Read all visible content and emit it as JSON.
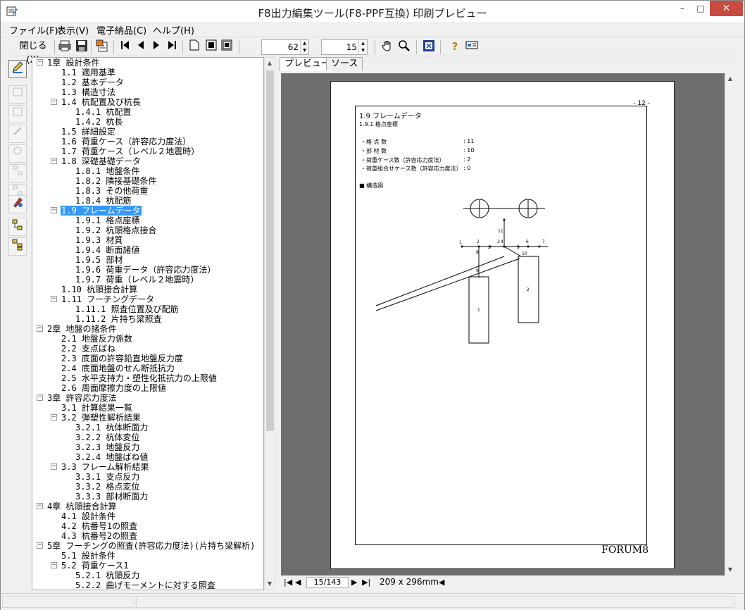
{
  "window": {
    "title": "F8出力編集ツール(F8-PPF互換) 印刷プレビュー",
    "minimize": "–",
    "maximize": "□",
    "close": "✕"
  },
  "menu": [
    "ファイル(F)",
    "表示(V)",
    "電子納品(C)",
    "ヘルプ(H)"
  ],
  "toolbar": {
    "close_label": "閉じる(X)",
    "zoom_value": "62",
    "page_value": "15"
  },
  "tabs": [
    "プレビュー",
    "ソース"
  ],
  "tree": [
    {
      "label": "1章 設計条件",
      "level": 0,
      "expander": "−"
    },
    {
      "label": "1.1 適用基準",
      "level": 1
    },
    {
      "label": "1.2 基本データ",
      "level": 1
    },
    {
      "label": "1.3 構造寸法",
      "level": 1
    },
    {
      "label": "1.4 杭配置及び杭長",
      "level": 1,
      "expander": "−"
    },
    {
      "label": "1.4.1 杭配置",
      "level": 2
    },
    {
      "label": "1.4.2 杭長",
      "level": 2
    },
    {
      "label": "1.5 詳細設定",
      "level": 1
    },
    {
      "label": "1.6 荷重ケース（許容応力度法）",
      "level": 1
    },
    {
      "label": "1.7 荷重ケース（レベル２地震時）",
      "level": 1
    },
    {
      "label": "1.8 深礎基礎データ",
      "level": 1,
      "expander": "−"
    },
    {
      "label": "1.8.1 地盤条件",
      "level": 2
    },
    {
      "label": "1.8.2 隣接基礎条件",
      "level": 2
    },
    {
      "label": "1.8.3 その他荷重",
      "level": 2
    },
    {
      "label": "1.8.4 杭配筋",
      "level": 2
    },
    {
      "label": "1.9 フレームデータ",
      "level": 1,
      "expander": "−",
      "selected": true
    },
    {
      "label": "1.9.1 格点座標",
      "level": 2
    },
    {
      "label": "1.9.2 杭頭格点接合",
      "level": 2
    },
    {
      "label": "1.9.3 材質",
      "level": 2
    },
    {
      "label": "1.9.4 断面諸値",
      "level": 2
    },
    {
      "label": "1.9.5 部材",
      "level": 2
    },
    {
      "label": "1.9.6 荷重データ（許容応力度法）",
      "level": 2
    },
    {
      "label": "1.9.7 荷重（レベル２地震時）",
      "level": 2
    },
    {
      "label": "1.10 杭頭接合計算",
      "level": 1
    },
    {
      "label": "1.11 フーチングデータ",
      "level": 1,
      "expander": "−"
    },
    {
      "label": "1.11.1 照査位置及び配筋",
      "level": 2
    },
    {
      "label": "1.11.2 片持ち梁照査",
      "level": 2
    },
    {
      "label": "2章 地盤の諸条件",
      "level": 0,
      "expander": "−"
    },
    {
      "label": "2.1 地盤反力係数",
      "level": 1
    },
    {
      "label": "2.2 支点ばね",
      "level": 1
    },
    {
      "label": "2.3 底面の許容鉛直地盤反力度",
      "level": 1
    },
    {
      "label": "2.4 底面地盤のせん断抵抗力",
      "level": 1
    },
    {
      "label": "2.5 水平支持力・塑性化抵抗力の上限値",
      "level": 1
    },
    {
      "label": "2.6 周面摩擦力度の上限値",
      "level": 1
    },
    {
      "label": "3章 許容応力度法",
      "level": 0,
      "expander": "−"
    },
    {
      "label": "3.1 計算結果一覧",
      "level": 1
    },
    {
      "label": "3.2 弾塑性解析結果",
      "level": 1,
      "expander": "−"
    },
    {
      "label": "3.2.1 杭体断面力",
      "level": 2
    },
    {
      "label": "3.2.2 杭体変位",
      "level": 2
    },
    {
      "label": "3.2.3 地盤反力",
      "level": 2
    },
    {
      "label": "3.2.4 地盤ばね値",
      "level": 2
    },
    {
      "label": "3.3 フレーム解析結果",
      "level": 1,
      "expander": "−"
    },
    {
      "label": "3.3.1 支点反力",
      "level": 2
    },
    {
      "label": "3.3.2 格点変位",
      "level": 2
    },
    {
      "label": "3.3.3 部材断面力",
      "level": 2
    },
    {
      "label": "4章 杭頭接合計算",
      "level": 0,
      "expander": "−"
    },
    {
      "label": "4.1 設計条件",
      "level": 1
    },
    {
      "label": "4.2 杭番号1の照査",
      "level": 1
    },
    {
      "label": "4.3 杭番号2の照査",
      "level": 1
    },
    {
      "label": "5章 フーチングの照査(許容応力度法)(片持ち梁解析)",
      "level": 0,
      "expander": "−"
    },
    {
      "label": "5.1 設計条件",
      "level": 1
    },
    {
      "label": "5.2 荷重ケース1",
      "level": 1,
      "expander": "−"
    },
    {
      "label": "5.2.1 杭頭反力",
      "level": 2
    },
    {
      "label": "5.2.2 曲げモーメントに対する照査",
      "level": 2
    }
  ],
  "document": {
    "page_number": "- 12 -",
    "section_title": "1.9 フレームデータ",
    "subsection_title": "1.9.1 格点座標",
    "stats": [
      {
        "label": "・格 点 数",
        "value": ": 11"
      },
      {
        "label": "・部 材 数",
        "value": ": 10"
      },
      {
        "label": "・荷重ケース数（許容応力度法）",
        "value": ": 2"
      },
      {
        "label": "・荷重組合せケース数（許容応力度法）",
        "value": ": 0"
      }
    ],
    "figure_caption": "■ 構造図",
    "node_labels": [
      "1",
      "2",
      "2",
      "3",
      "4",
      "5",
      "6",
      "7",
      "8",
      "9",
      "10",
      "11"
    ],
    "pile_labels": [
      "1",
      "2"
    ],
    "footer": "FORUM8"
  },
  "navigation": {
    "page_indicator": "15/143",
    "paper_size": "209 x 296mm"
  },
  "icons": [
    "app-icon",
    "print-icon",
    "save-icon",
    "export-icon",
    "first-page-icon",
    "prev-page-icon",
    "next-page-icon",
    "last-page-icon",
    "single-page-icon",
    "two-page-icon",
    "multi-page-icon",
    "hand-icon",
    "zoom-icon",
    "fit-icon",
    "help-icon",
    "info-icon"
  ]
}
